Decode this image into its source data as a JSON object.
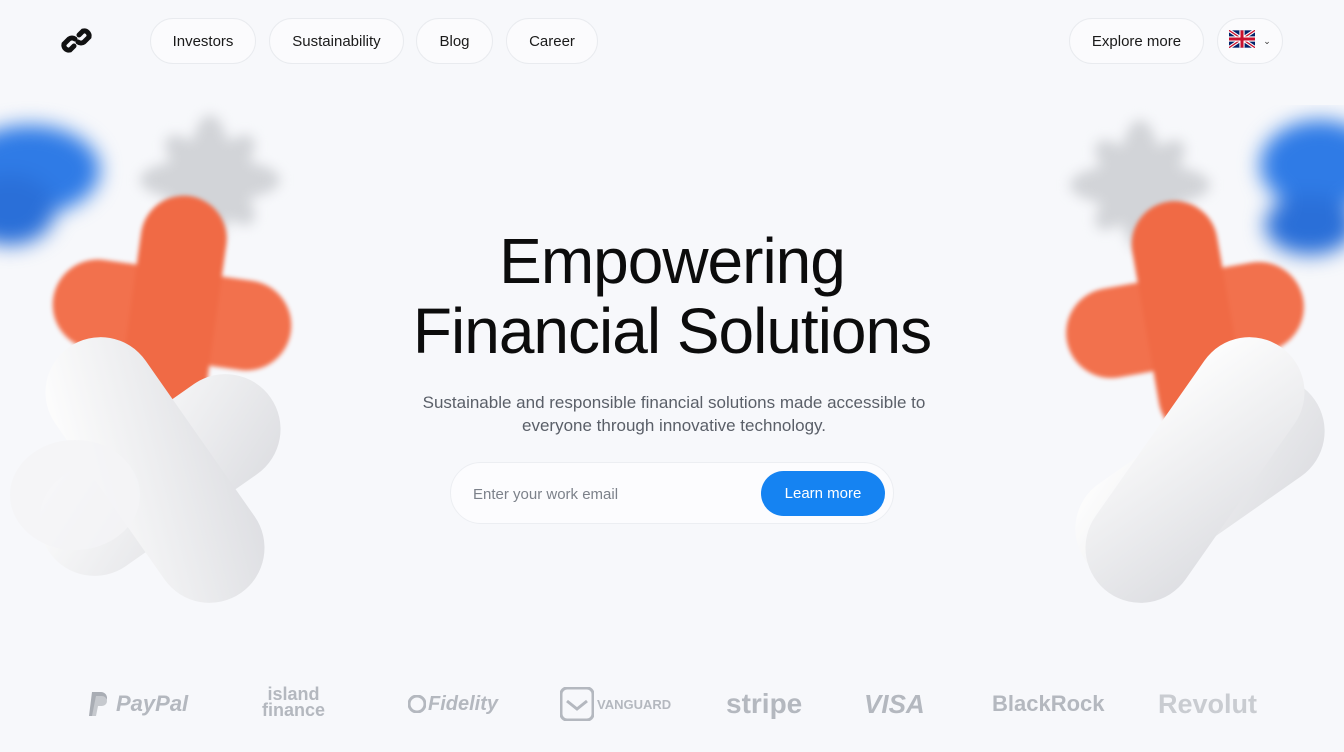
{
  "nav": {
    "logo_icon": "chain-link-icon",
    "links": [
      {
        "label": "Investors"
      },
      {
        "label": "Sustainability"
      },
      {
        "label": "Blog"
      },
      {
        "label": "Career"
      }
    ],
    "explore_label": "Explore more",
    "language_icon": "uk-flag-icon"
  },
  "hero": {
    "title_line1": "Empowering",
    "title_line2": "Financial Solutions",
    "subtitle_line1": "Sustainable and responsible financial solutions made accessible to",
    "subtitle_line2": "everyone through innovative technology.",
    "email_placeholder": "Enter your work email",
    "email_value": "",
    "cta_label": "Learn more"
  },
  "partners": [
    {
      "name": "PayPal",
      "icon": "paypal-logo"
    },
    {
      "name": "island",
      "name2": "finance",
      "icon": "island-finance-logo"
    },
    {
      "name": "Fidelity",
      "icon": "fidelity-logo"
    },
    {
      "name": "VANGUARD",
      "icon": "vanguard-logo"
    },
    {
      "name": "stripe",
      "icon": "stripe-logo"
    },
    {
      "name": "VISA",
      "icon": "visa-logo"
    },
    {
      "name": "BlackRock",
      "icon": "blackrock-logo"
    },
    {
      "name": "Revolut",
      "icon": "revolut-logo"
    }
  ],
  "colors": {
    "accent": "#1583f2",
    "background": "#f7f8fb",
    "coral": "#f2714d",
    "partner_gray": "#b4b8bf"
  }
}
